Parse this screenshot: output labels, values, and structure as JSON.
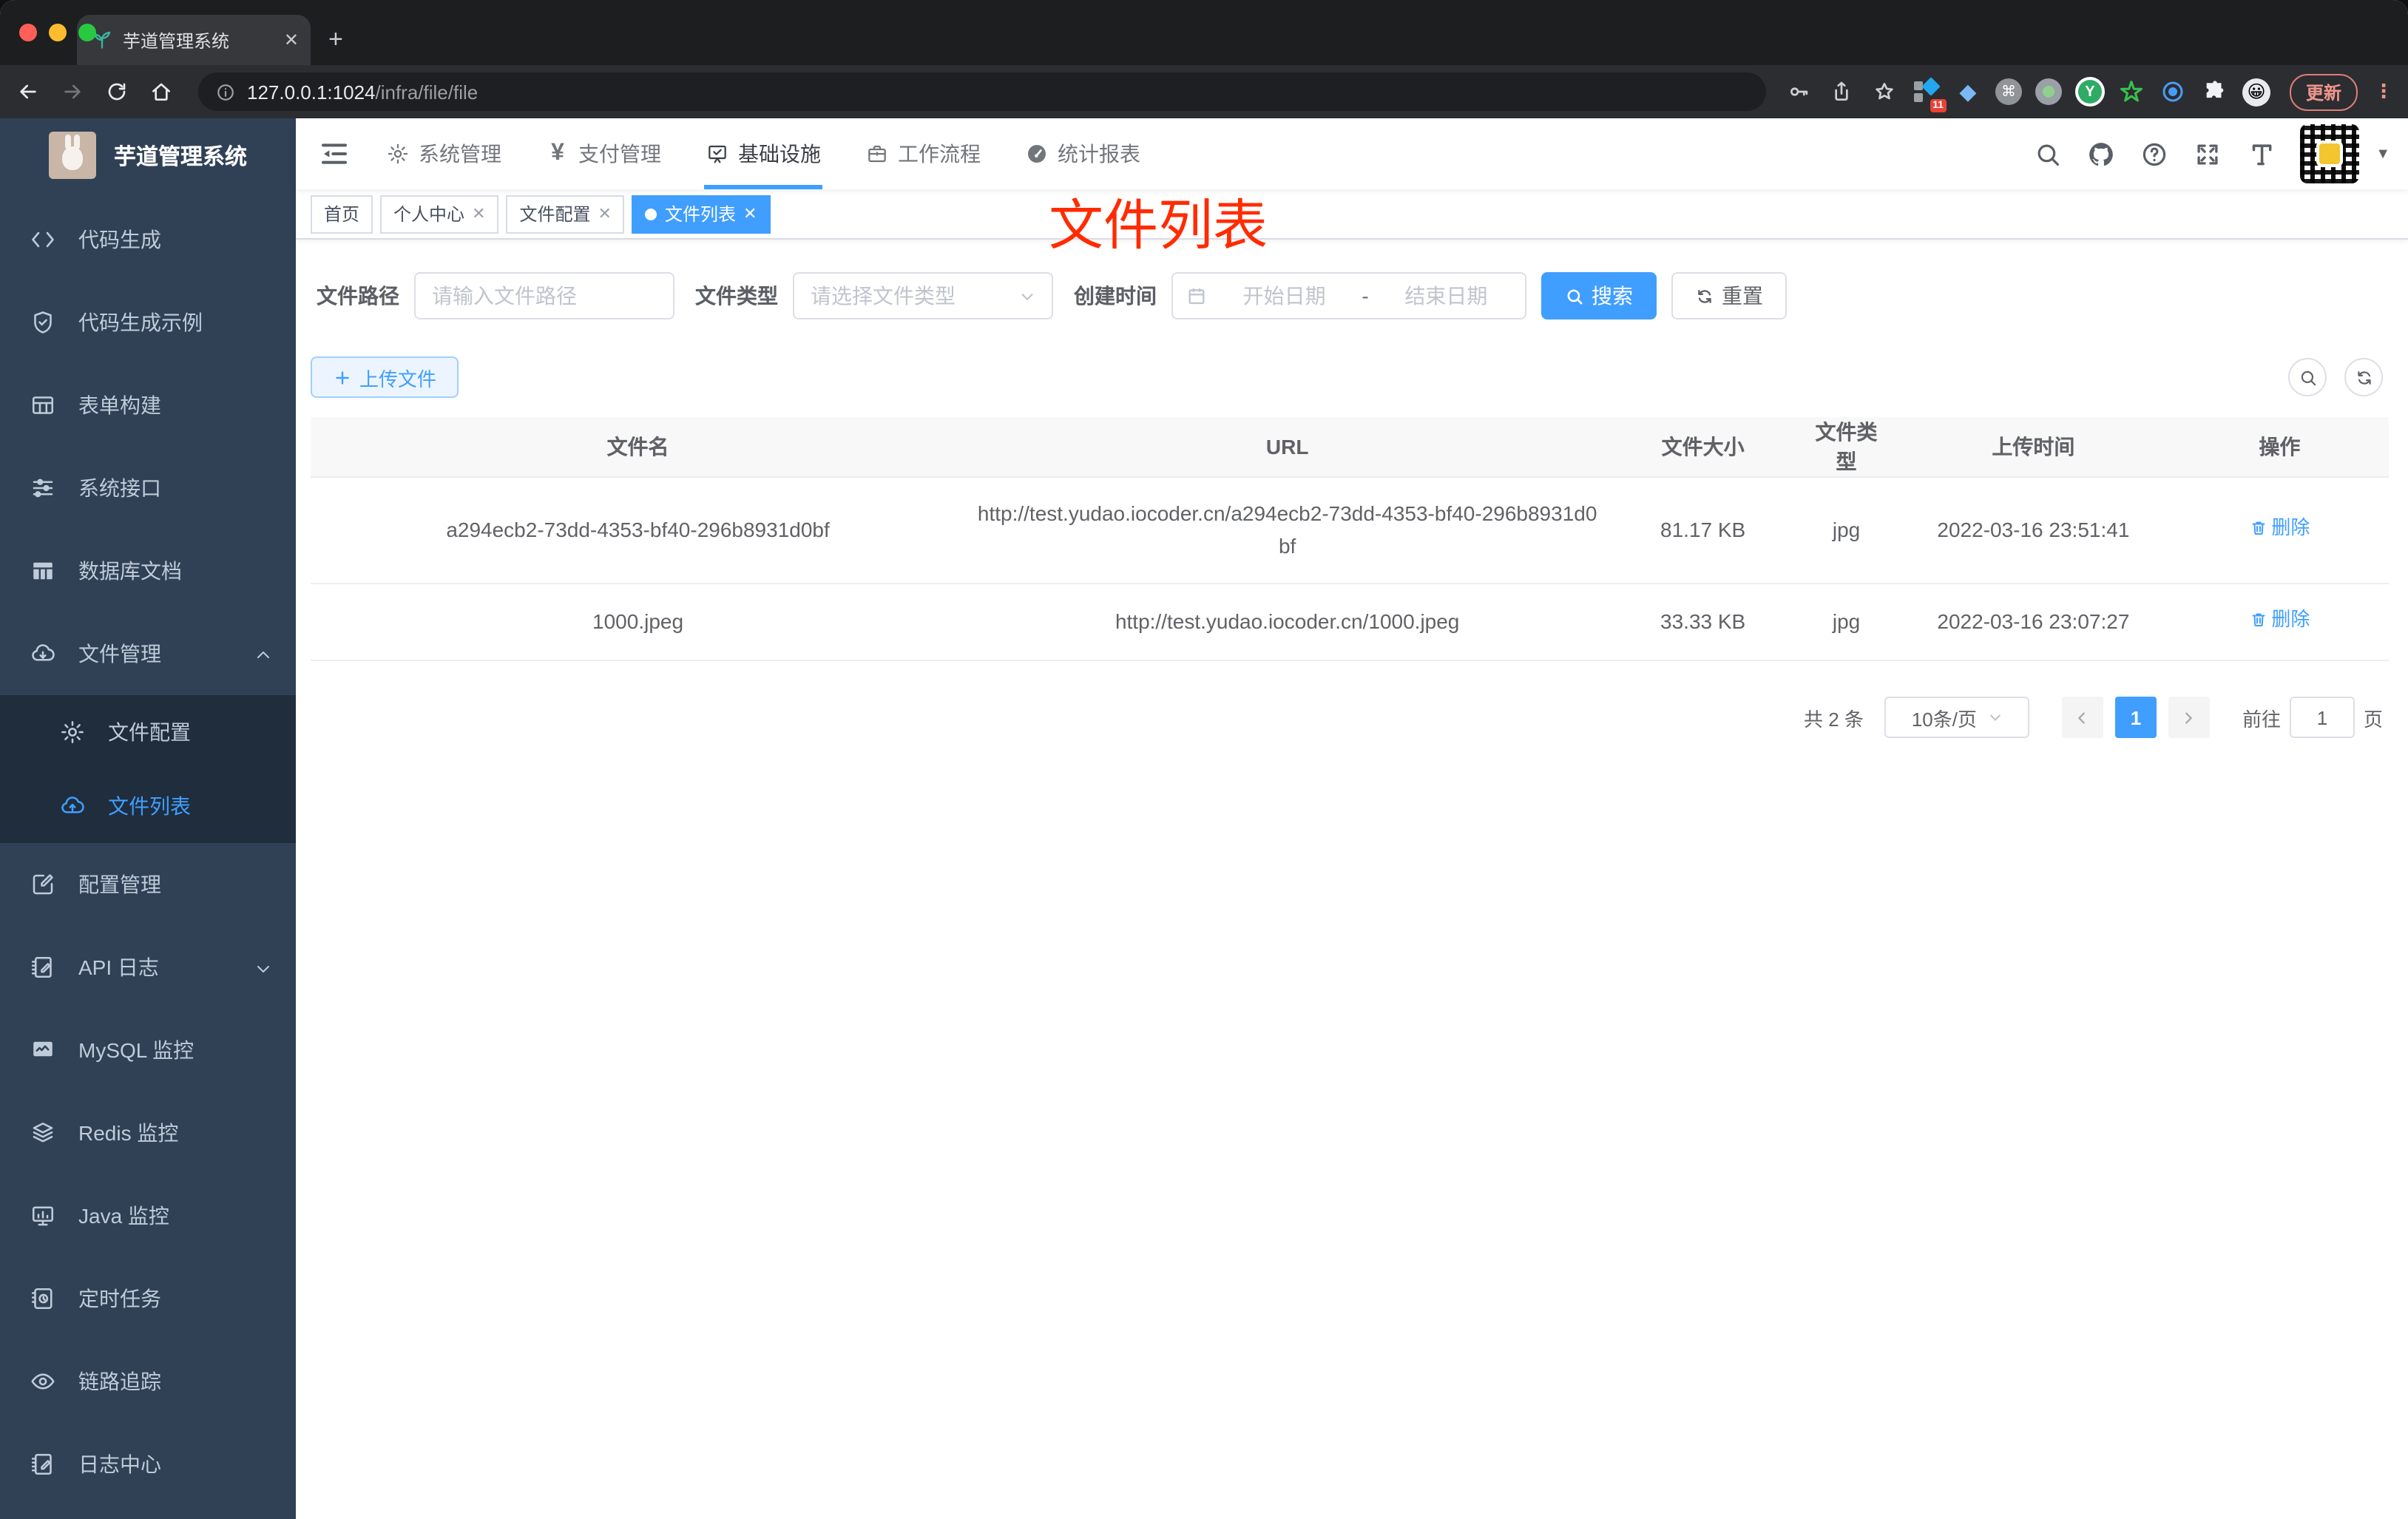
{
  "browser": {
    "tab_title": "芋道管理系统",
    "close_tab": "✕",
    "new_tab": "+",
    "url_host": "127.0.0.1:1024",
    "url_path": "/infra/file/file",
    "ext_badge": "11",
    "yudao_ext_letter": "Y",
    "command_glyph": "⌘",
    "emoji_face": "😀",
    "update_label": "更新",
    "kebab_glyph": "⋮"
  },
  "sidebar": {
    "logo_title": "芋道管理系统",
    "items": [
      {
        "icon": "code",
        "label": "代码生成"
      },
      {
        "icon": "shield-check",
        "label": "代码生成示例"
      },
      {
        "icon": "form-grid",
        "label": "表单构建"
      },
      {
        "icon": "sliders",
        "label": "系统接口"
      },
      {
        "icon": "db-table",
        "label": "数据库文档"
      },
      {
        "icon": "cloud-download",
        "label": "文件管理",
        "expanded": true,
        "children": [
          {
            "icon": "gear",
            "label": "文件配置"
          },
          {
            "icon": "cloud-upload",
            "label": "文件列表",
            "active": true
          }
        ]
      },
      {
        "icon": "edit-square",
        "label": "配置管理"
      },
      {
        "icon": "doc-pen",
        "label": "API 日志",
        "collapsed": true
      },
      {
        "icon": "monitor-chart",
        "label": "MySQL 监控"
      },
      {
        "icon": "layers",
        "label": "Redis 监控"
      },
      {
        "icon": "monitor",
        "label": "Java 监控"
      },
      {
        "icon": "book-clock",
        "label": "定时任务"
      },
      {
        "icon": "eye",
        "label": "链路追踪"
      },
      {
        "icon": "doc-pen",
        "label": "日志中心"
      }
    ]
  },
  "topnav": {
    "items": [
      {
        "icon": "gear",
        "label": "系统管理"
      },
      {
        "icon": "yen",
        "label": "支付管理"
      },
      {
        "icon": "infra-check",
        "label": "基础设施",
        "active": true
      },
      {
        "icon": "briefcase",
        "label": "工作流程"
      },
      {
        "icon": "gauge",
        "label": "统计报表"
      }
    ]
  },
  "tags": [
    {
      "label": "首页"
    },
    {
      "label": "个人中心",
      "closable": true
    },
    {
      "label": "文件配置",
      "closable": true
    },
    {
      "label": "文件列表",
      "closable": true,
      "active": true
    }
  ],
  "annotation": "文件列表",
  "filters": {
    "path_label": "文件路径",
    "path_placeholder": "请输入文件路径",
    "type_label": "文件类型",
    "type_placeholder": "请选择文件类型",
    "date_label": "创建时间",
    "date_start": "开始日期",
    "date_separator": "-",
    "date_end": "结束日期",
    "search_label": "搜索",
    "reset_label": "重置"
  },
  "toolbar": {
    "upload_label": "上传文件"
  },
  "table": {
    "columns": [
      "文件名",
      "URL",
      "文件大小",
      "文件类型",
      "上传时间",
      "操作"
    ],
    "col_widths": [
      "31.5%",
      "31%",
      "9%",
      "4.8%",
      "13.2%",
      "10.5%"
    ],
    "rows": [
      {
        "name": "a294ecb2-73dd-4353-bf40-296b8931d0bf",
        "url": "http://test.yudao.iocoder.cn/a294ecb2-73dd-4353-bf40-296b8931d0bf",
        "size": "81.17 KB",
        "type": "jpg",
        "time": "2022-03-16 23:51:41",
        "action": "删除"
      },
      {
        "name": "1000.jpeg",
        "url": "http://test.yudao.iocoder.cn/1000.jpeg",
        "size": "33.33 KB",
        "type": "jpg",
        "time": "2022-03-16 23:07:27",
        "action": "删除"
      }
    ]
  },
  "pagination": {
    "total": "共 2 条",
    "page_size": "10条/页",
    "current_page": "1",
    "goto_label": "前往",
    "goto_value": "1",
    "unit_label": "页"
  },
  "colors": {
    "primary": "#409eff",
    "sidebar_bg": "#304156",
    "submenu_bg": "#1f2d3d",
    "annotation_red": "#ff2b01"
  }
}
